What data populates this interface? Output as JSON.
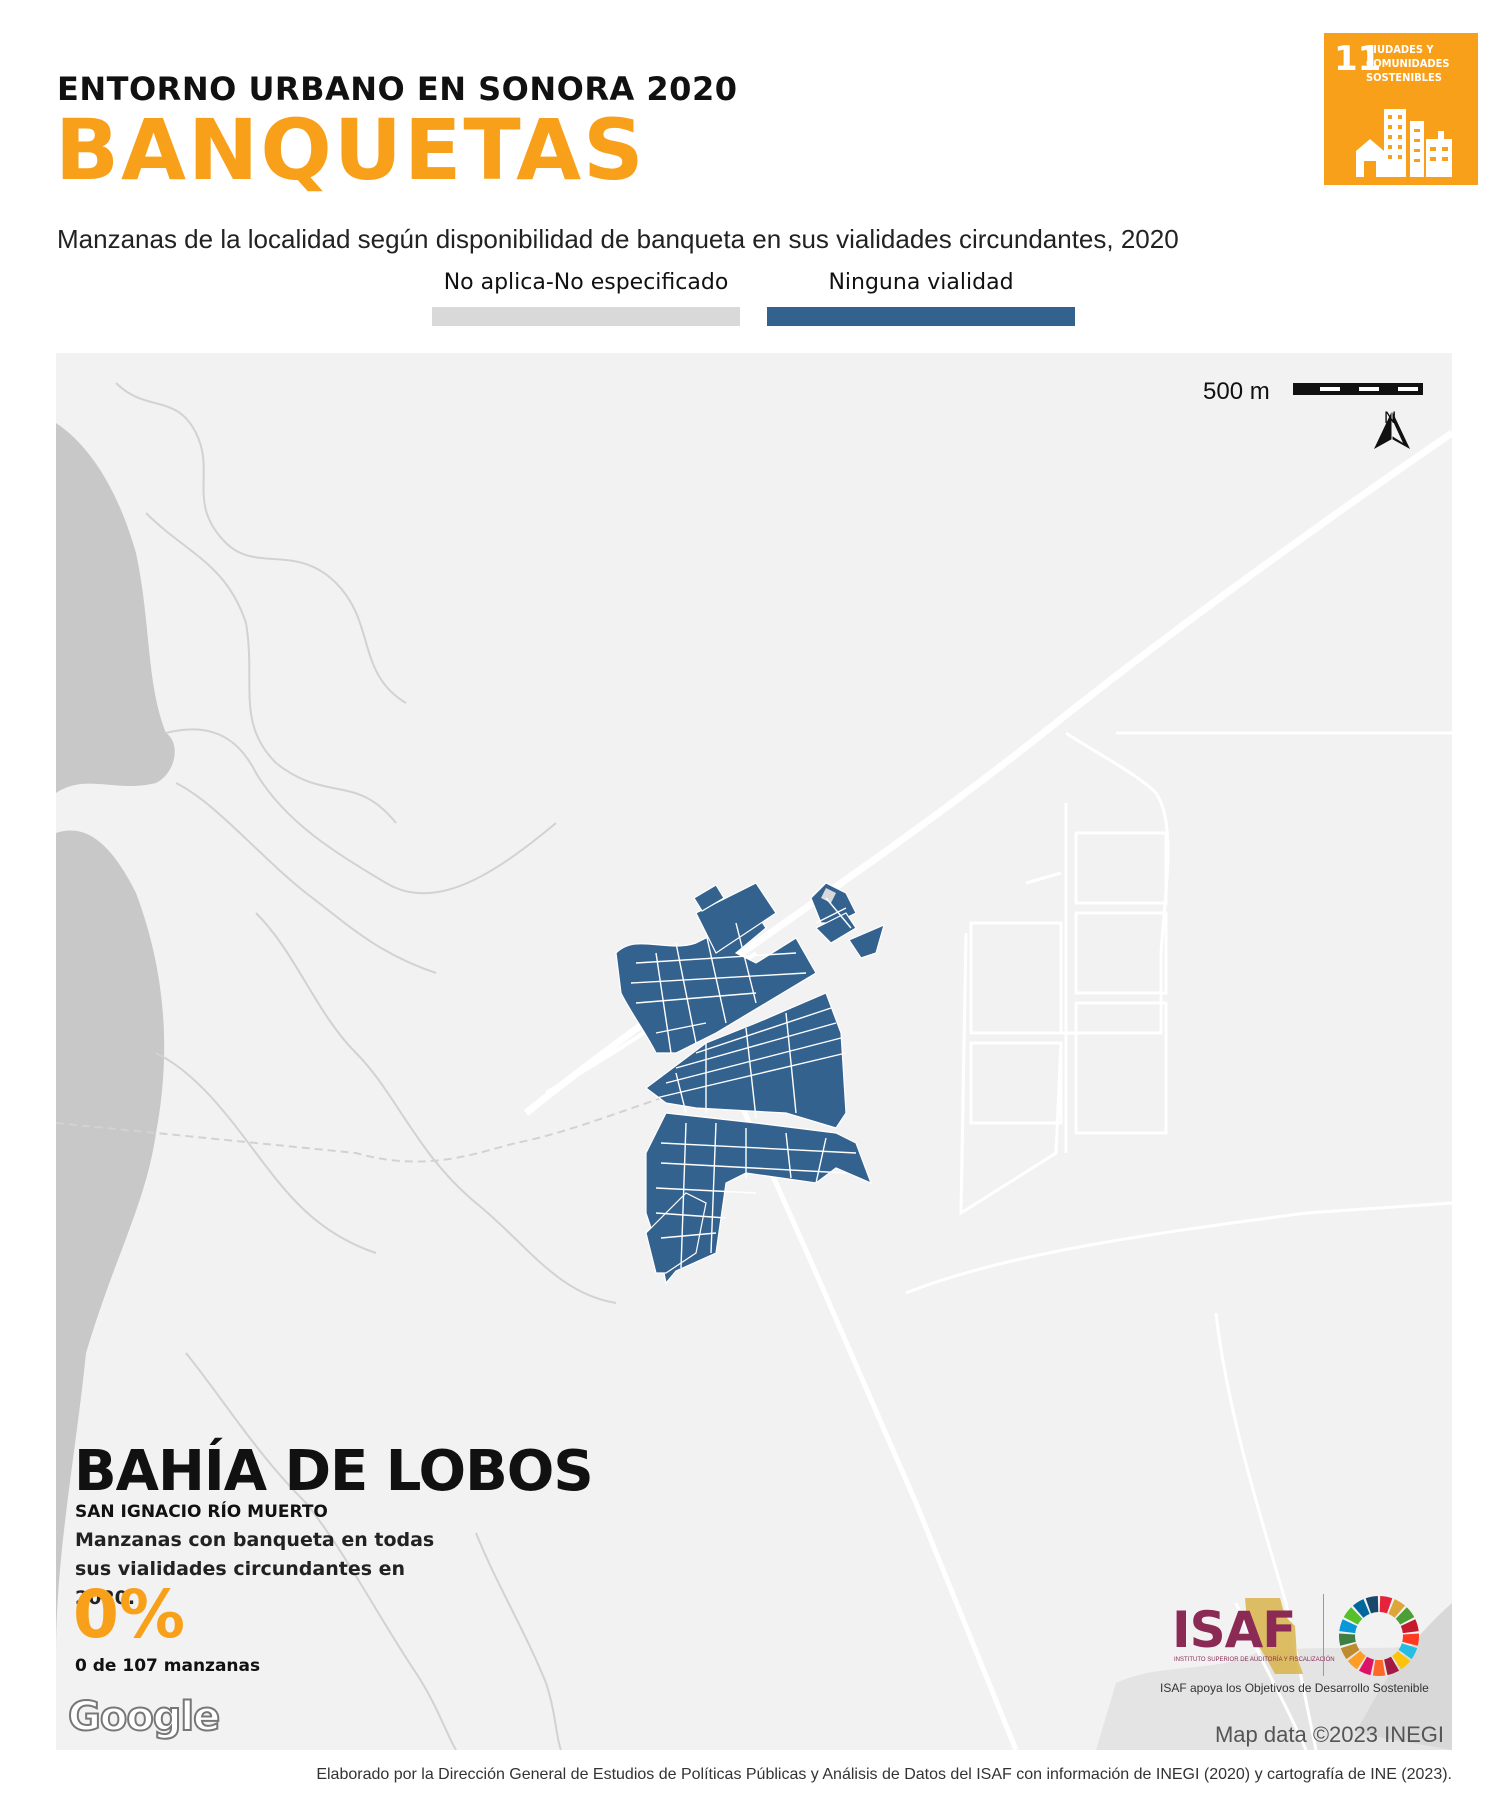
{
  "header": {
    "kicker": "ENTORNO URBANO EN SONORA 2020",
    "title": "BANQUETAS",
    "subtitle": "Manzanas de la localidad según disponibilidad de banqueta en sus vialidades circundantes, 2020"
  },
  "legend": [
    {
      "label": "No aplica-No especificado",
      "color": "#d9d9d9"
    },
    {
      "label": "Ninguna vialidad",
      "color": "#33628f"
    }
  ],
  "sdg_badge": {
    "number": "11",
    "text": "CIUDADES Y COMUNIDADES SOSTENIBLES",
    "color": "#f8a01a"
  },
  "map": {
    "scale_label": "500 m",
    "north_label": "N",
    "attribution": "Map data ©2023 INEGI",
    "provider_logo": "Google",
    "colors": {
      "land": "#f2f2f2",
      "water": "#c8c8c8",
      "roads": "#ffffff",
      "blocks": "#33628f"
    }
  },
  "summary": {
    "locality": "BAHÍA DE LOBOS",
    "municipality": "SAN IGNACIO RÍO MUERTO",
    "description": "Manzanas con banqueta en todas sus vialidades circundantes en 2020.",
    "percent": "0%",
    "count_text": "0 de 107 manzanas"
  },
  "logos": {
    "isaf_word": "ISAF",
    "isaf_subtitle": "INSTITUTO SUPERIOR DE AUDITORÍA Y FISCALIZACIÓN",
    "tagline": "ISAF apoya los Objetivos de Desarrollo Sostenible"
  },
  "footer": {
    "credits": "Elaborado por la Dirección General de Estudios de Políticas Públicas y Análisis de Datos del ISAF con información de INEGI (2020) y cartografía de INE (2023)."
  }
}
